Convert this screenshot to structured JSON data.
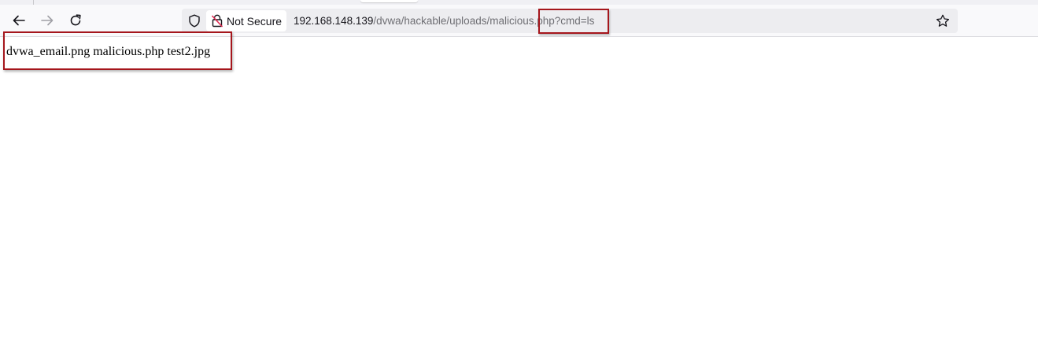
{
  "browser": {
    "nav": {
      "back_icon": "arrow-left-icon",
      "forward_icon": "arrow-right-icon",
      "reload_icon": "reload-icon"
    },
    "urlbar": {
      "tracking_icon": "shield-icon",
      "security_icon": "broken-lock-icon",
      "security_label": "Not Secure",
      "url_host": "192.168.148.139",
      "url_path": "/dvwa/hackable/uploads/malicious.php?cmd=ls",
      "bookmark_icon": "star-icon"
    }
  },
  "page": {
    "output_text": "dvwa_email.png malicious.php test2.jpg"
  },
  "annotations": {
    "highlight_color": "#a5161c"
  }
}
